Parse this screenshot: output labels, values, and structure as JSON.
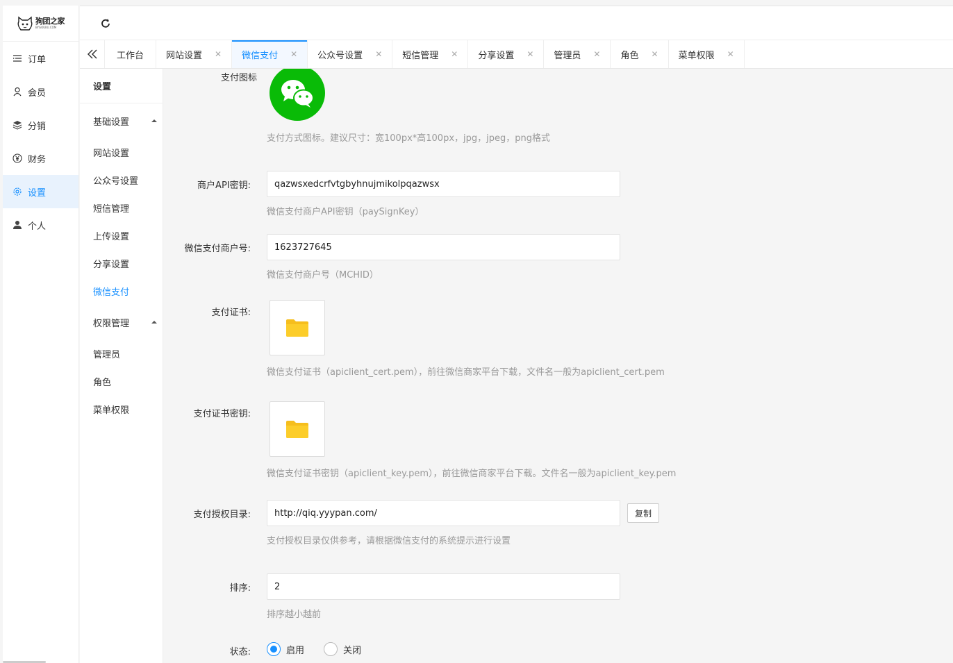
{
  "logo": {
    "name": "狗团之家",
    "sub": "BYGOUKU.COM"
  },
  "sidebar": {
    "items": [
      {
        "label": "订单",
        "icon": "list-icon"
      },
      {
        "label": "会员",
        "icon": "user-icon"
      },
      {
        "label": "分销",
        "icon": "layers-icon"
      },
      {
        "label": "财务",
        "icon": "yen-icon"
      },
      {
        "label": "设置",
        "icon": "gear-icon"
      },
      {
        "label": "个人",
        "icon": "person-icon"
      }
    ]
  },
  "tabs": [
    {
      "label": "工作台"
    },
    {
      "label": "网站设置"
    },
    {
      "label": "微信支付"
    },
    {
      "label": "公众号设置"
    },
    {
      "label": "短信管理"
    },
    {
      "label": "分享设置"
    },
    {
      "label": "管理员"
    },
    {
      "label": "角色"
    },
    {
      "label": "菜单权限"
    }
  ],
  "subnav": {
    "title": "设置",
    "group1": "基础设置",
    "group1_items": [
      "网站设置",
      "公众号设置",
      "短信管理",
      "上传设置",
      "分享设置",
      "微信支付"
    ],
    "group2": "权限管理",
    "group2_items": [
      "管理员",
      "角色",
      "菜单权限"
    ]
  },
  "form": {
    "pay_icon_label": "支付图标",
    "pay_icon_hint": "支付方式图标。建议尺寸：宽100px*高100px，jpg，jpeg，png格式",
    "api_key_label": "商户API密钥:",
    "api_key_value": "qazwsxedcrfvtgbyhnujmikolpqazwsx",
    "api_key_hint": "微信支付商户API密钥（paySignKey）",
    "mchid_label": "微信支付商户号:",
    "mchid_value": "1623727645",
    "mchid_hint": "微信支付商户号（MCHID）",
    "cert_label": "支付证书:",
    "cert_hint": "微信支付证书（apiclient_cert.pem），前往微信商家平台下载，文件名一般为apiclient_cert.pem",
    "cert_key_label": "支付证书密钥:",
    "cert_key_hint": "微信支付证书密钥（apiclient_key.pem），前往微信商家平台下载。文件名一般为apiclient_key.pem",
    "auth_dir_label": "支付授权目录:",
    "auth_dir_value": "http://qiq.yyypan.com/",
    "copy_label": "复制",
    "auth_dir_hint": "支付授权目录仅供参考，请根据微信支付的系统提示进行设置",
    "sort_label": "排序:",
    "sort_value": "2",
    "sort_hint": "排序越小越前",
    "status_label": "状态:",
    "status_on": "启用",
    "status_off": "关闭"
  }
}
